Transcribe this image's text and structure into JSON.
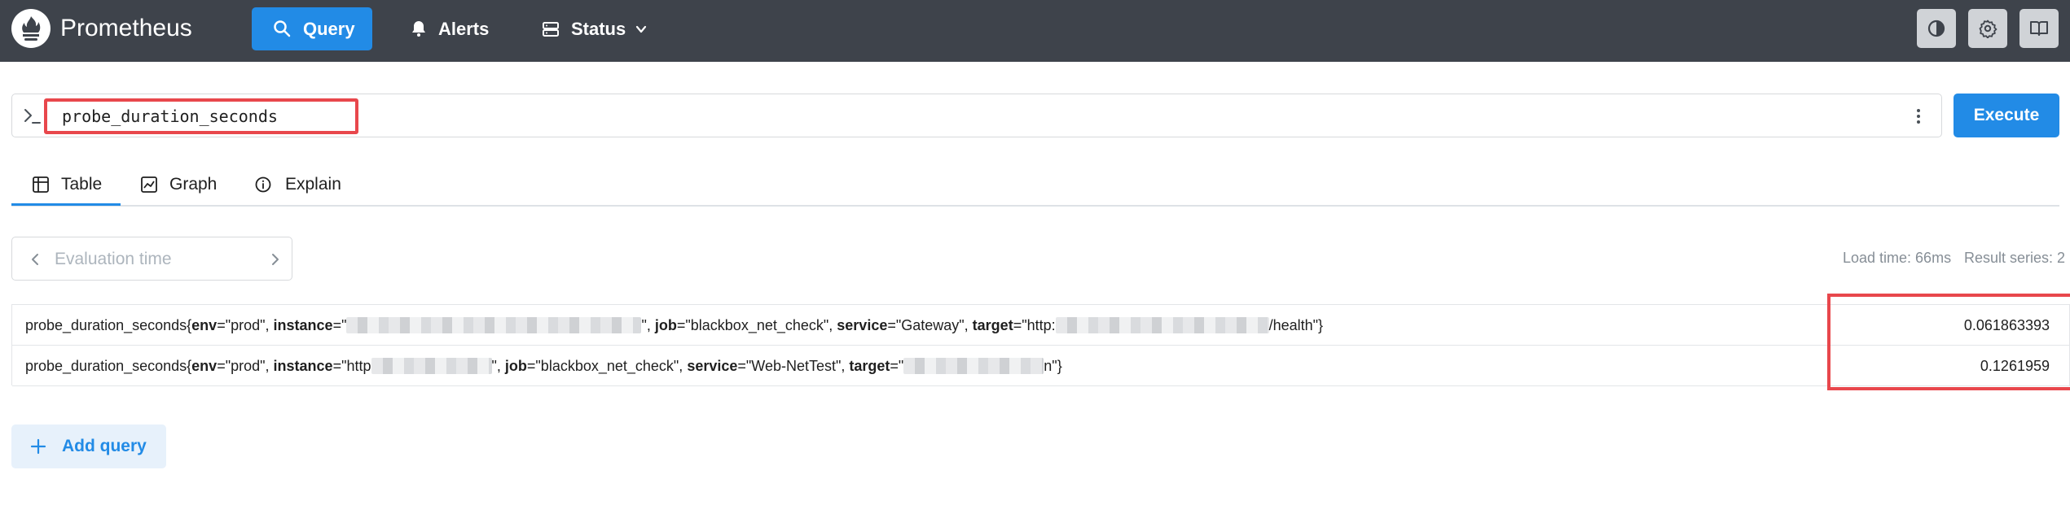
{
  "header": {
    "brand": "Prometheus",
    "nav": [
      {
        "label": "Query",
        "icon": "search-icon",
        "active": true
      },
      {
        "label": "Alerts",
        "icon": "bell-icon"
      },
      {
        "label": "Status",
        "icon": "server-icon"
      }
    ],
    "actions": [
      "theme-toggle-icon",
      "gear-icon",
      "book-icon"
    ]
  },
  "query": {
    "expression": "probe_duration_seconds",
    "execute_label": "Execute"
  },
  "tabs": [
    {
      "label": "Table",
      "icon": "table-icon",
      "active": true
    },
    {
      "label": "Graph",
      "icon": "graph-icon"
    },
    {
      "label": "Explain",
      "icon": "info-icon"
    }
  ],
  "eval": {
    "placeholder": "Evaluation time"
  },
  "stats": {
    "load_time": "Load time: 66ms",
    "result_series": "Result series: 2"
  },
  "results": [
    {
      "metric": "probe_duration_seconds{",
      "env_key": "env",
      "env_val": "=\"prod\", ",
      "instance_key": "instance",
      "instance_val_pre": "=\"",
      "instance_val_post": "\", ",
      "job_key": "job",
      "job_val": "=\"blackbox_net_check\", ",
      "service_key": "service",
      "service_val": "=\"Gateway\", ",
      "target_key": "target",
      "target_val_pre": "=\"http:",
      "target_val_post": "/health\"}",
      "value": "0.061863393"
    },
    {
      "metric": "probe_duration_seconds{",
      "env_key": "env",
      "env_val": "=\"prod\", ",
      "instance_key": "instance",
      "instance_val_pre": "=\"http",
      "instance_val_post": "\", ",
      "job_key": "job",
      "job_val": "=\"blackbox_net_check\", ",
      "service_key": "service",
      "service_val": "=\"Web-NetTest\", ",
      "target_key": "target",
      "target_val_pre": "=\"",
      "target_val_post": "n\"}",
      "value": "0.1261959"
    }
  ],
  "add_query_label": "Add query",
  "colors": {
    "header_bg": "#3e434b",
    "accent": "#228be6",
    "highlight": "#e8474c"
  }
}
